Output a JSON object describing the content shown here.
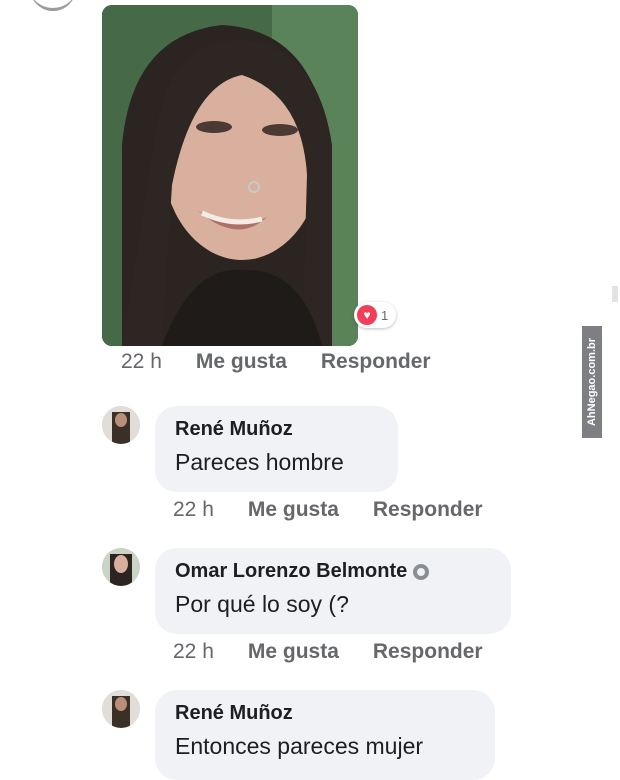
{
  "post": {
    "reaction_count": "1",
    "meta": {
      "time": "22 h",
      "like": "Me gusta",
      "reply": "Responder"
    }
  },
  "comments": [
    {
      "name": "René Muñoz",
      "text": "Pareces hombre",
      "time": "22 h",
      "like": "Me gusta",
      "reply": "Responder"
    },
    {
      "name": "Omar Lorenzo Belmonte",
      "text": "Por qué lo soy (?",
      "time": "22 h",
      "like": "Me gusta",
      "reply": "Responder"
    },
    {
      "name": "René Muñoz",
      "text": "Entonces pareces mujer"
    }
  ],
  "watermark": "AhNegao.com.br"
}
